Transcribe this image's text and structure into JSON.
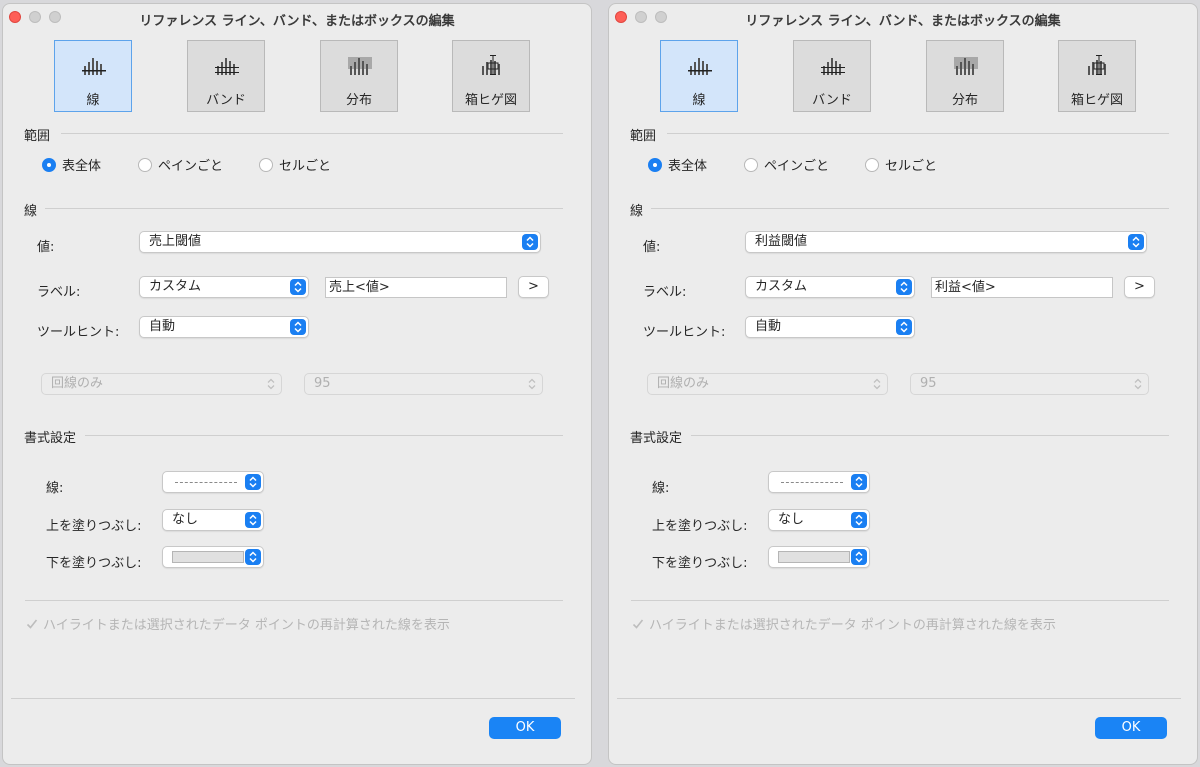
{
  "windows": [
    {
      "title": "リファレンス ライン、バンド、またはボックスの編集",
      "type_buttons": [
        {
          "label": "線",
          "icon": "line-chart-icon",
          "active": true
        },
        {
          "label": "バンド",
          "icon": "band-chart-icon",
          "active": false
        },
        {
          "label": "分布",
          "icon": "distribution-chart-icon",
          "active": false
        },
        {
          "label": "箱ヒゲ図",
          "icon": "box-plot-icon",
          "active": false
        }
      ],
      "scope": {
        "heading": "範囲",
        "options": [
          {
            "label": "表全体",
            "selected": true
          },
          {
            "label": "ペインごと",
            "selected": false
          },
          {
            "label": "セルごと",
            "selected": false
          }
        ]
      },
      "line": {
        "heading": "線",
        "value_label": "値:",
        "value_selected": "売上閾値",
        "label_label": "ラベル:",
        "label_selected": "カスタム",
        "label_text": "売上<値>",
        "insert_button": ">",
        "tooltip_label": "ツールヒント:",
        "tooltip_selected": "自動",
        "disabled_select_1": "回線のみ",
        "disabled_select_2": "95"
      },
      "format": {
        "heading": "書式設定",
        "line_label": "線:",
        "fill_above_label": "上を塗りつぶし:",
        "fill_above_selected": "なし",
        "fill_below_label": "下を塗りつぶし:"
      },
      "recalc_checkbox": "ハイライトまたは選択されたデータ ポイントの再計算された線を表示",
      "ok_button": "OK"
    },
    {
      "title": "リファレンス ライン、バンド、またはボックスの編集",
      "type_buttons": [
        {
          "label": "線",
          "icon": "line-chart-icon",
          "active": true
        },
        {
          "label": "バンド",
          "icon": "band-chart-icon",
          "active": false
        },
        {
          "label": "分布",
          "icon": "distribution-chart-icon",
          "active": false
        },
        {
          "label": "箱ヒゲ図",
          "icon": "box-plot-icon",
          "active": false
        }
      ],
      "scope": {
        "heading": "範囲",
        "options": [
          {
            "label": "表全体",
            "selected": true
          },
          {
            "label": "ペインごと",
            "selected": false
          },
          {
            "label": "セルごと",
            "selected": false
          }
        ]
      },
      "line": {
        "heading": "線",
        "value_label": "値:",
        "value_selected": "利益閾値",
        "label_label": "ラベル:",
        "label_selected": "カスタム",
        "label_text": "利益<値>",
        "insert_button": ">",
        "tooltip_label": "ツールヒント:",
        "tooltip_selected": "自動",
        "disabled_select_1": "回線のみ",
        "disabled_select_2": "95"
      },
      "format": {
        "heading": "書式設定",
        "line_label": "線:",
        "fill_above_label": "上を塗りつぶし:",
        "fill_above_selected": "なし",
        "fill_below_label": "下を塗りつぶし:"
      },
      "recalc_checkbox": "ハイライトまたは選択されたデータ ポイントの再計算された線を表示",
      "ok_button": "OK"
    }
  ],
  "colors": {
    "accent": "#1a7ff2",
    "close": "#fe5f57",
    "active_tile": "#d3e5fa"
  }
}
